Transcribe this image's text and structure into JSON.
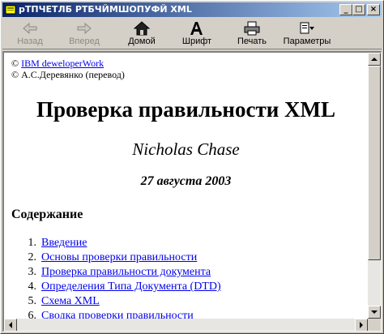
{
  "window": {
    "title": "рТПЧЕТЛБ РТБЧЙМШОПУФЙ XML",
    "minimize_glyph": "_",
    "maximize_glyph": "□",
    "close_glyph": "×"
  },
  "toolbar": {
    "back_label": "Назад",
    "forward_label": "Вперед",
    "home_label": "Домой",
    "font_label": "Шрифт",
    "print_label": "Печать",
    "options_label": "Параметры"
  },
  "document": {
    "copyright_prefix": "©",
    "copyright_link": "IBM deweloperWork",
    "copyright_line2": "© А.С.Деревянко (перевод)",
    "title": "Проверка правильности XML",
    "author": "Nicholas Chase",
    "date": "27 августа 2003",
    "toc_heading": "Содержание",
    "toc": [
      {
        "num": "1.",
        "label": "Введение"
      },
      {
        "num": "2.",
        "label": "Основы проверки правильности"
      },
      {
        "num": "3.",
        "label": "Проверка правильности документа"
      },
      {
        "num": "4.",
        "label": "Определения Типа Документа (DTD)"
      },
      {
        "num": "5.",
        "label": "Схема XML"
      },
      {
        "num": "6.",
        "label": "Сводка проверки правильности"
      }
    ]
  },
  "colors": {
    "title_bar_start": "#0a246a",
    "title_bar_end": "#a6caf0",
    "link": "#0000ee",
    "chrome": "#d4d0c8"
  }
}
